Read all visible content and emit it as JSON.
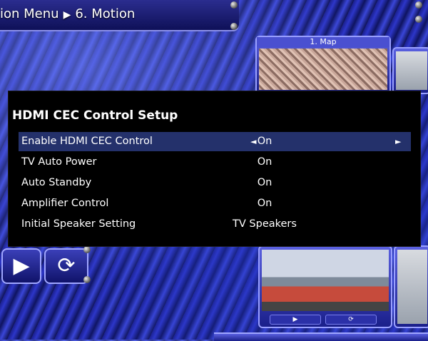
{
  "breadcrumb": {
    "menu": "ion Menu",
    "section": "6. Motion"
  },
  "thumbnail": {
    "map_label": "1. Map"
  },
  "dialog": {
    "title": "HDMI CEC Control Setup",
    "rows": [
      {
        "label": "Enable HDMI CEC Control",
        "value": "On",
        "selected": true
      },
      {
        "label": "TV Auto Power",
        "value": "On",
        "selected": false
      },
      {
        "label": "Auto Standby",
        "value": "On",
        "selected": false
      },
      {
        "label": "Amplifier Control",
        "value": "On",
        "selected": false
      },
      {
        "label": "Initial Speaker Setting",
        "value": "TV Speakers",
        "selected": false
      }
    ],
    "left_arrow": "◄",
    "right_arrow": "►"
  },
  "colors": {
    "dialog_background": "#000000",
    "selected_row": "#24316b",
    "background_blue": "#1a1f8a"
  }
}
